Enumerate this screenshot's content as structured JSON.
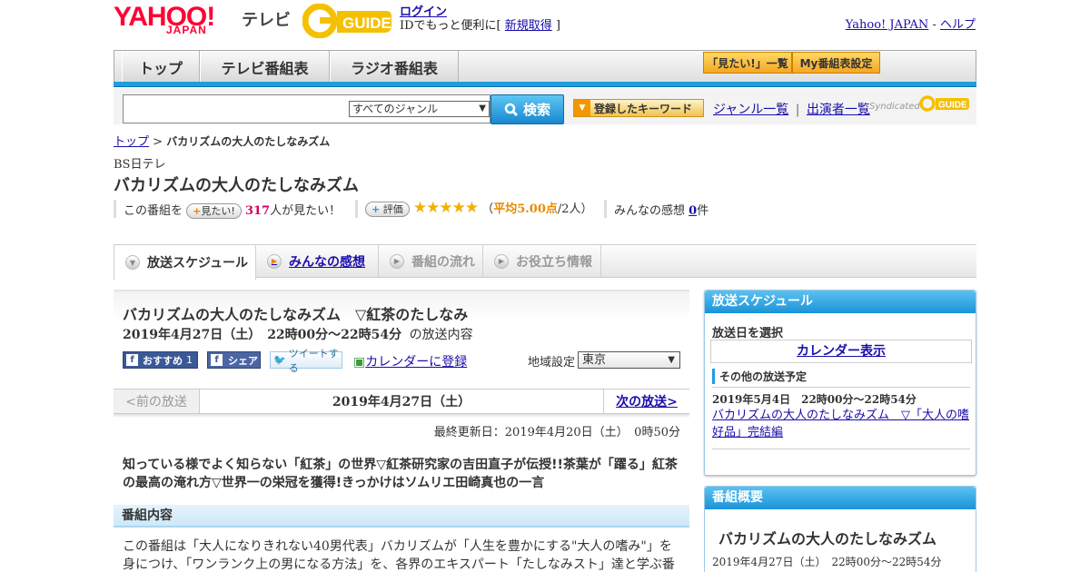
{
  "header": {
    "logo_yahoo": "YAHOO!",
    "logo_japan": "JAPAN",
    "logo_tv": "テレビ",
    "logo_gguide": "GUIDE",
    "login_link": "ログイン",
    "login_note_prefix": "IDでもっと便利に[ ",
    "signup_link": "新規取得",
    "login_note_suffix": " ]",
    "yahoo_japan_link": "Yahoo! JAPAN",
    "separator": " - ",
    "help_link": "ヘルプ"
  },
  "nav": {
    "tabs": [
      "トップ",
      "テレビ番組表",
      "ラジオ番組表"
    ],
    "want_list": "「見たい!」一覧",
    "my_schedule": "My番組表設定"
  },
  "search": {
    "genre_selected": "すべてのジャンル",
    "button_label": "検索",
    "keyword_button": "登録したキーワード",
    "genre_list_link": "ジャンル一覧",
    "divider": "|",
    "performer_list_link": "出演者一覧",
    "syndicated": "Syndicated"
  },
  "breadcrumb": {
    "top_link": "トップ",
    "sep": " > ",
    "current": "バカリズムの大人のたしなみズム"
  },
  "program": {
    "channel": "BS日テレ",
    "title": "バカリズムの大人のたしなみズム",
    "want_prefix": "この番組を",
    "want_button": "見たい!",
    "want_count": "317",
    "want_suffix": "人が見たい！",
    "rating_button": "評価",
    "stars": "★★★★★",
    "rating_open": "（",
    "rating_avg": "平均5.00点",
    "rating_count": "/2人）",
    "comments_prefix": "みんなの感想",
    "comments_count": "0",
    "comments_suffix": "件"
  },
  "tabs": {
    "schedule": "放送スケジュール",
    "reviews": "みんなの感想",
    "flow": "番組の流れ",
    "info": "お役立ち情報"
  },
  "episode": {
    "title": "バカリズムの大人のたしなみズム　▽紅茶のたしなみ",
    "datetime": "2019年4月27日（土）　22時00分～22時54分",
    "datetime_suffix": "の放送内容",
    "share_recommend": "おすすめ",
    "share_recommend_count": "1",
    "share_facebook": "シェア",
    "share_tweet": "ツイートする",
    "calendar_link": "カレンダーに登録",
    "region_label": "地域設定",
    "region_selected": "東京",
    "prev": "<前の放送",
    "date": "2019年4月27日（土）",
    "next": "次の放送>",
    "updated": "最終更新日：2019年4月20日（土）　0時50分",
    "summary": "知っている様でよく知らない「紅茶」の世界▽紅茶研究家の吉田直子が伝授!!茶葉が「躍る」紅茶の最高の淹れ方▽世界一の栄冠を獲得!きっかけはソムリエ田崎真也の一言",
    "section_header": "番組内容",
    "section_text": "この番組は「大人になりきれない40男代表」バカリズムが「人生を豊かにする\"大人の嗜み\"」を身につけ、「ワンランク上の男になる方法」を、各界のエキスパート「たしなみスト」達と学ぶ番"
  },
  "sidebar": {
    "schedule_header": "放送スケジュール",
    "select_date": "放送日を選択",
    "calendar_link": "カレンダー表示",
    "other_header": "その他の放送予定",
    "other_date": "2019年5月4日　22時00分～22時54分",
    "other_link": "バカリズムの大人のたしなみズム　▽「大人の嗜好品」完結編",
    "overview_header": "番組概要",
    "overview_title": "バカリズムの大人のたしなみズム",
    "overview_date": "2019年4月27日（土）　22時00分～22時54分"
  },
  "colors": {
    "accent_blue": "#1e9ee0",
    "yahoo_red": "#ff0033",
    "want_count_pink": "#d6005c",
    "rating_orange": "#e58a00",
    "star_gold": "#f3b000"
  }
}
